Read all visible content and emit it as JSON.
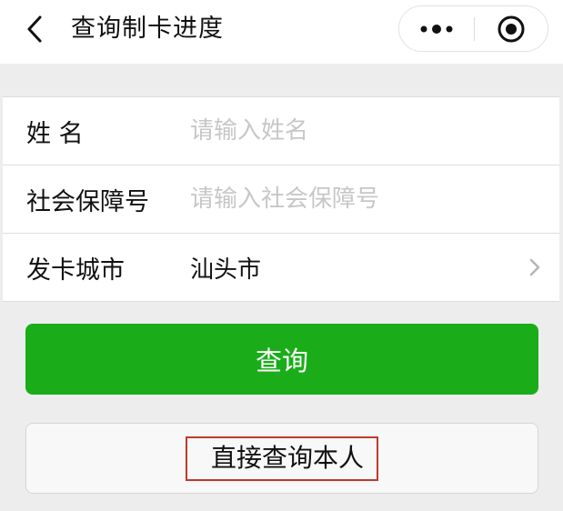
{
  "navbar": {
    "title": "查询制卡进度",
    "back_icon": "chevron-left-icon",
    "more_icon": "more-dots-icon",
    "close_icon": "target-close-icon"
  },
  "form": {
    "rows": [
      {
        "label": "姓 名",
        "placeholder": "请输入姓名",
        "value": ""
      },
      {
        "label": "社会保障号",
        "placeholder": "请输入社会保障号",
        "value": ""
      },
      {
        "label": "发卡城市",
        "value": "汕头市",
        "icon": "chevron-right-icon"
      }
    ]
  },
  "buttons": {
    "query_label": "查询",
    "self_query_label": "直接查询本人"
  },
  "colors": {
    "primary_green": "#1aad19",
    "highlight_box": "#c0392b",
    "background": "#ededed"
  }
}
